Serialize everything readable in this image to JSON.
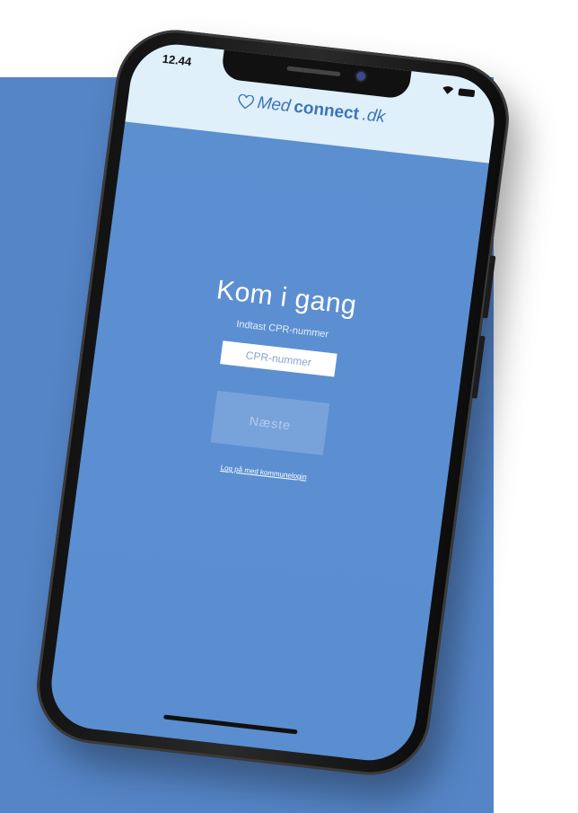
{
  "status_bar": {
    "time": "12.44"
  },
  "brand": {
    "part1": "Med",
    "part2": "connect",
    "part3": ".dk"
  },
  "login": {
    "title": "Kom i gang",
    "subtitle": "Indtast CPR-nummer",
    "cpr_placeholder": "CPR-nummer",
    "next_label": "Næste",
    "alt_login_link": "Log på med kommunelogin"
  },
  "icons": {
    "wifi": "wifi-icon",
    "battery": "battery-icon",
    "logo": "heart-icon"
  },
  "colors": {
    "background_square": "#5585c7",
    "screen": "#5b8fd2",
    "header": "#dff0fa",
    "brand": "#3e73b8"
  }
}
